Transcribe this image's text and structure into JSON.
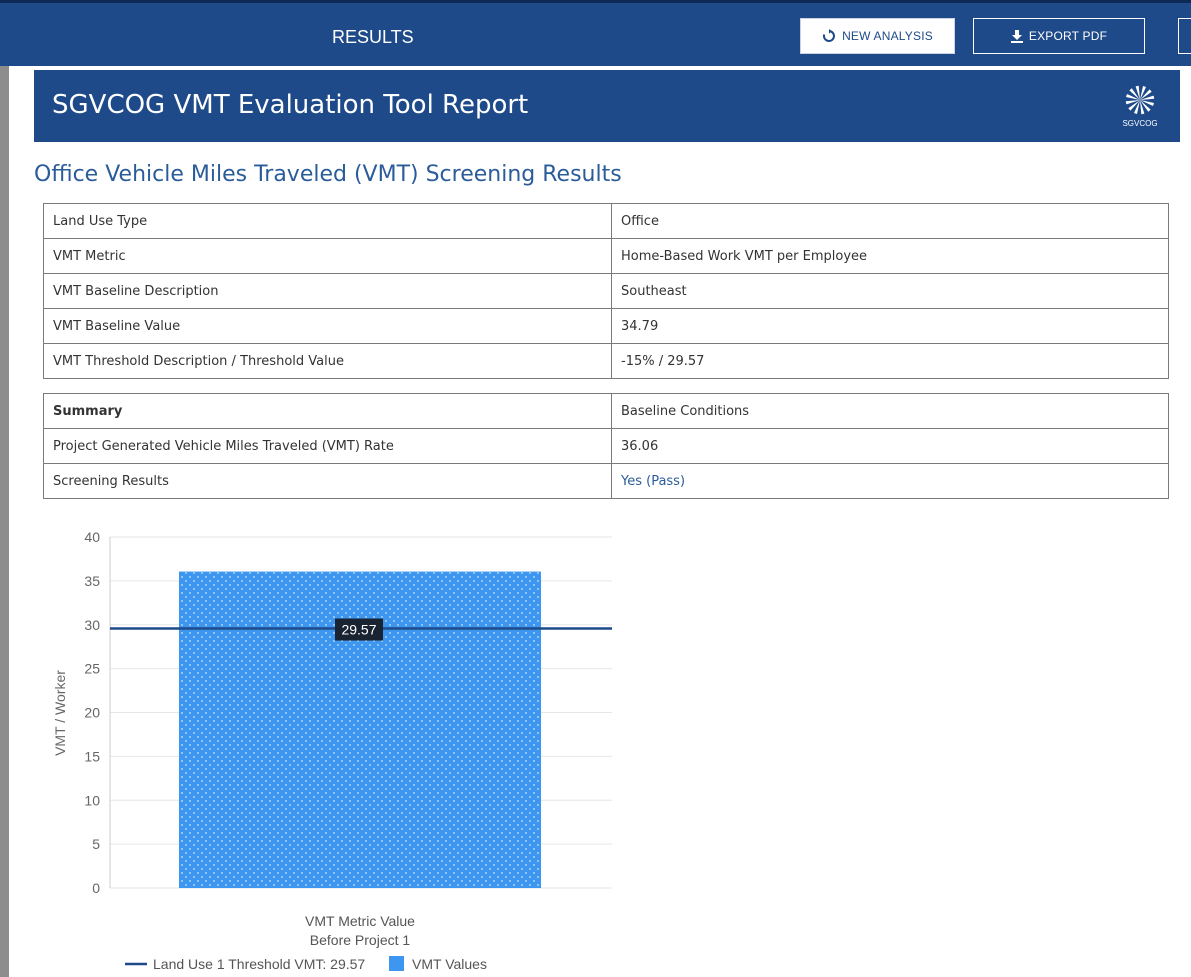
{
  "topbar": {
    "title": "RESULTS",
    "new_analysis_label": "NEW ANALYSIS",
    "export_pdf_label": "EXPORT PDF"
  },
  "report": {
    "title": "SGVCOG VMT Evaluation Tool Report",
    "logo_text": "SGVCOG",
    "section_title": "Office Vehicle Miles Traveled (VMT) Screening Results"
  },
  "table1": [
    {
      "label": "Land Use Type",
      "value": "Office"
    },
    {
      "label": "VMT Metric",
      "value": "Home-Based Work VMT per Employee"
    },
    {
      "label": "VMT Baseline Description",
      "value": "Southeast"
    },
    {
      "label": "VMT Baseline Value",
      "value": "34.79"
    },
    {
      "label": "VMT Threshold Description / Threshold Value",
      "value": "-15% / 29.57"
    }
  ],
  "table2": {
    "header": {
      "label": "Summary",
      "value": "Baseline Conditions"
    },
    "rows": [
      {
        "label": "Project Generated Vehicle Miles Traveled (VMT) Rate",
        "value": "36.06"
      },
      {
        "label": "Screening Results",
        "value": "Yes (Pass)"
      }
    ]
  },
  "colors": {
    "brand": "#1e4a8a",
    "bar": "#3d96f0",
    "threshold": "#1e4a8a",
    "pass": "#2b5c9a"
  },
  "chart_data": {
    "type": "bar",
    "categories": [
      "VMT Metric Value\nBefore Project 1"
    ],
    "category_lines": [
      "VMT Metric Value",
      "Before Project 1"
    ],
    "series": [
      {
        "name": "VMT Values",
        "values": [
          36.06
        ]
      }
    ],
    "threshold": {
      "name": "Land Use 1 Threshold VMT: 29.57",
      "value": 29.57,
      "label": "29.57"
    },
    "ylabel": "VMT / Worker",
    "ylim": [
      0,
      40
    ],
    "yticks": [
      0,
      5,
      10,
      15,
      20,
      25,
      30,
      35,
      40
    ],
    "grid": true,
    "legend_position": "bottom"
  }
}
